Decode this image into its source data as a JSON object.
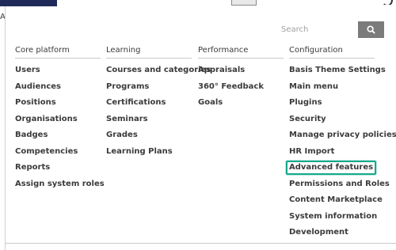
{
  "header": {
    "cutoff_text": "Ad"
  },
  "search": {
    "placeholder": "Search",
    "icon": "search-icon"
  },
  "columns": [
    {
      "heading": "Core platform",
      "items": [
        "Users",
        "Audiences",
        "Positions",
        "Organisations",
        "Badges",
        "Competencies",
        "Reports",
        "Assign system roles"
      ]
    },
    {
      "heading": "Learning",
      "items": [
        "Courses and categories",
        "Programs",
        "Certifications",
        "Seminars",
        "Grades",
        "Learning Plans"
      ]
    },
    {
      "heading": "Performance",
      "items": [
        "Appraisals",
        "360° Feedback",
        "Goals"
      ]
    },
    {
      "heading": "Configuration",
      "items": [
        "Basis Theme Settings",
        "Main menu",
        "Plugins",
        "Security",
        "Manage privacy policies",
        "HR Import",
        "Advanced features",
        "Permissions and Roles",
        "Content Marketplace",
        "System information",
        "Development"
      ]
    }
  ],
  "colors": {
    "brand": "#1f2a59",
    "highlight": "#17a88c",
    "search_button": "#7b7b7b"
  }
}
